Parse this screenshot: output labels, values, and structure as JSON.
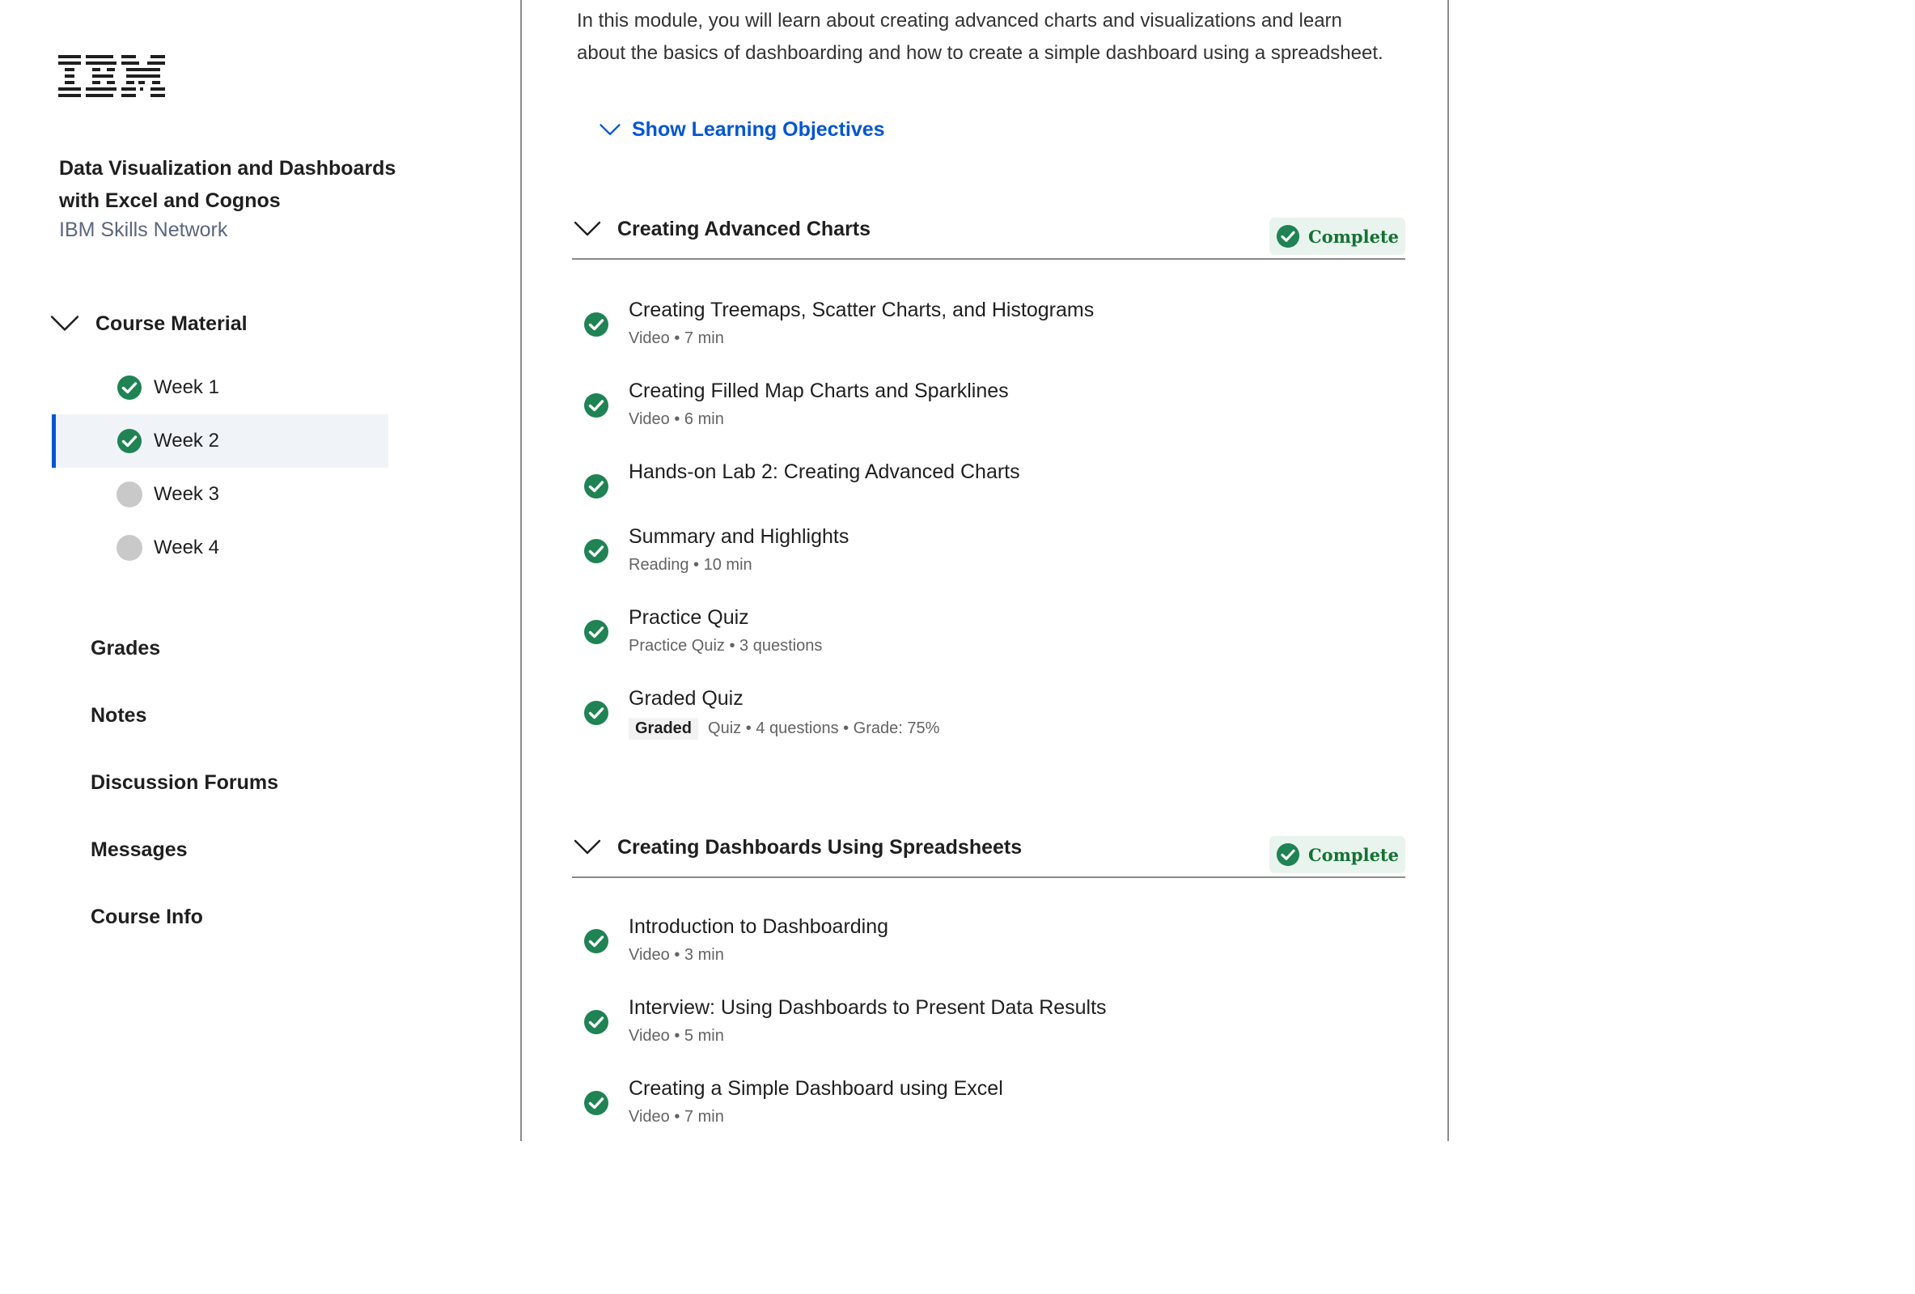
{
  "brand": {
    "logo_text": "IBM"
  },
  "course": {
    "title": "Data Visualization and Dashboards with Excel and Cognos",
    "partner": "IBM Skills Network"
  },
  "sidebar": {
    "course_material_label": "Course Material",
    "weeks": [
      {
        "label": "Week 1",
        "status": "complete"
      },
      {
        "label": "Week 2",
        "status": "complete",
        "active": true
      },
      {
        "label": "Week 3",
        "status": "incomplete"
      },
      {
        "label": "Week 4",
        "status": "incomplete"
      }
    ],
    "links": [
      "Grades",
      "Notes",
      "Discussion Forums",
      "Messages",
      "Course Info"
    ]
  },
  "main": {
    "intro": "In this module, you will learn about creating advanced charts and visualizations and learn about the basics of dashboarding and how to create a simple dashboard using a spreadsheet.",
    "show_objectives_label": "Show Learning Objectives",
    "sections": [
      {
        "title": "Creating Advanced Charts",
        "badge": "Complete",
        "items": [
          {
            "name": "Creating Treemaps, Scatter Charts, and Histograms",
            "meta": "Video • 7 min"
          },
          {
            "name": "Creating Filled Map Charts and Sparklines",
            "meta": "Video • 6 min"
          },
          {
            "name": "Hands-on Lab 2: Creating Advanced Charts",
            "meta": ""
          },
          {
            "name": "Summary and Highlights",
            "meta": "Reading • 10 min"
          },
          {
            "name": "Practice Quiz",
            "meta": "Practice Quiz • 3 questions"
          },
          {
            "name": "Graded Quiz",
            "tag": "Graded",
            "meta": "Quiz • 4 questions • Grade: 75%"
          }
        ]
      },
      {
        "title": "Creating Dashboards Using Spreadsheets",
        "badge": "Complete",
        "items": [
          {
            "name": "Introduction to Dashboarding",
            "meta": "Video • 3 min"
          },
          {
            "name": "Interview: Using Dashboards to Present Data Results",
            "meta": "Video • 5 min"
          },
          {
            "name": "Creating a Simple Dashboard using Excel",
            "meta": "Video • 7 min"
          }
        ]
      }
    ]
  },
  "colors": {
    "accent_blue": "#0056d2",
    "complete_green": "#1f8354",
    "incomplete_grey": "#c9c9c9"
  }
}
